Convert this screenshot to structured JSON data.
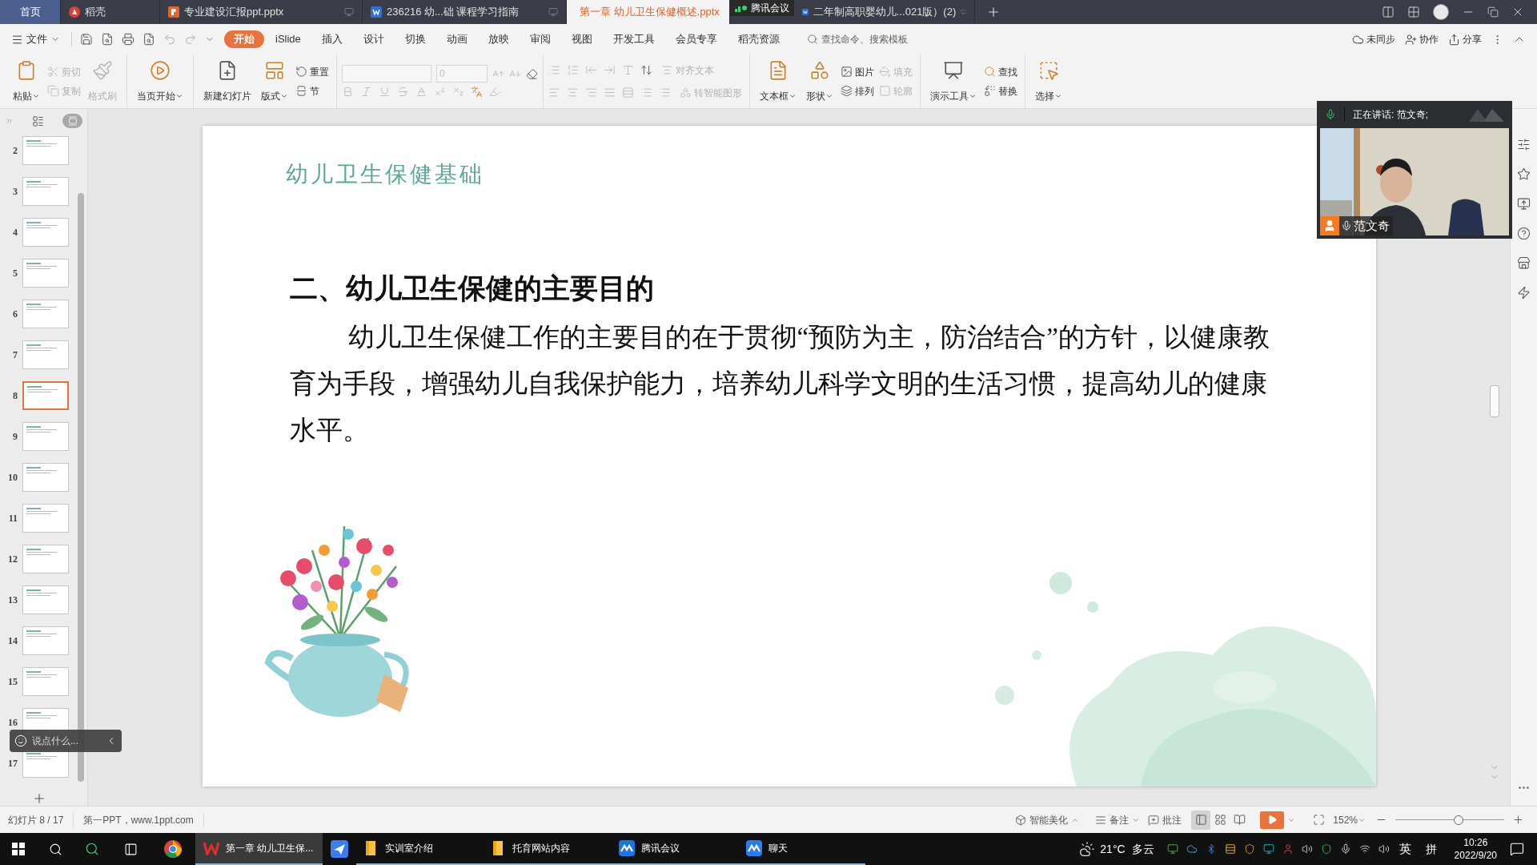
{
  "tabs": [
    {
      "label": "首页",
      "kind": "home",
      "selected": false
    },
    {
      "label": "稻壳",
      "kind": "docer",
      "selected": false
    },
    {
      "label": "专业建设汇报ppt.pptx",
      "kind": "pptx",
      "selected": false
    },
    {
      "label": "236216  幼...础  课程学习指南",
      "kind": "doc",
      "selected": false
    },
    {
      "label": "第一章 幼儿卫生保健概述.pptx",
      "kind": "pptx",
      "selected": true
    },
    {
      "label": "二年制高职婴幼儿...021版）(2)",
      "kind": "doc",
      "selected": false
    }
  ],
  "meeting_indicator": "腾讯会议",
  "menu": {
    "file": "文件",
    "tabs": [
      {
        "label": "开始",
        "selected": true
      },
      {
        "label": "iSlide",
        "selected": false
      },
      {
        "label": "插入",
        "selected": false
      },
      {
        "label": "设计",
        "selected": false
      },
      {
        "label": "切换",
        "selected": false
      },
      {
        "label": "动画",
        "selected": false
      },
      {
        "label": "放映",
        "selected": false
      },
      {
        "label": "审阅",
        "selected": false
      },
      {
        "label": "视图",
        "selected": false
      },
      {
        "label": "开发工具",
        "selected": false
      },
      {
        "label": "会员专享",
        "selected": false
      },
      {
        "label": "稻壳资源",
        "selected": false
      }
    ],
    "search": {
      "placeholder": "查找命令、搜索模板"
    },
    "sync": "未同步",
    "collaborate": "协作",
    "share": "分享"
  },
  "ribbon": {
    "paste": {
      "label": "粘贴",
      "disabled": false
    },
    "cut": {
      "label": "剪切",
      "disabled": true
    },
    "copy": {
      "label": "复制",
      "disabled": true
    },
    "format_painter": {
      "label": "格式刷",
      "disabled": true
    },
    "play_from_current": {
      "label": "当页开始",
      "disabled": false
    },
    "new_slide": {
      "label": "新建幻灯片",
      "disabled": false
    },
    "layout": {
      "label": "版式",
      "disabled": false
    },
    "reset": {
      "label": "重置",
      "disabled": false
    },
    "section": {
      "label": "节",
      "disabled": false
    },
    "font_size": {
      "value": "0"
    },
    "align_text": {
      "label": "对齐文本",
      "disabled": true
    },
    "smartart": {
      "label": "转智能图形",
      "disabled": true
    },
    "text_box": {
      "label": "文本框",
      "disabled": false
    },
    "shape": {
      "label": "形状",
      "disabled": false
    },
    "picture": {
      "label": "图片",
      "disabled": false
    },
    "fill": {
      "label": "填充",
      "disabled": true
    },
    "arrange": {
      "label": "排列",
      "disabled": false
    },
    "outline": {
      "label": "轮廓",
      "disabled": true
    },
    "presentation_tools": {
      "label": "演示工具",
      "disabled": false
    },
    "find": {
      "label": "查找",
      "disabled": false
    },
    "replace": {
      "label": "替换",
      "disabled": false
    },
    "select": {
      "label": "选择",
      "disabled": false
    }
  },
  "panel_views": [
    {
      "selected": false
    },
    {
      "selected": true
    }
  ],
  "slides": [
    {
      "number": "2",
      "selected": false
    },
    {
      "number": "3",
      "selected": false
    },
    {
      "number": "4",
      "selected": false
    },
    {
      "number": "5",
      "selected": false
    },
    {
      "number": "6",
      "selected": false
    },
    {
      "number": "7",
      "selected": false
    },
    {
      "number": "8",
      "selected": true
    },
    {
      "number": "9",
      "selected": false
    },
    {
      "number": "10",
      "selected": false
    },
    {
      "number": "11",
      "selected": false
    },
    {
      "number": "12",
      "selected": false
    },
    {
      "number": "13",
      "selected": false
    },
    {
      "number": "14",
      "selected": false
    },
    {
      "number": "15",
      "selected": false
    },
    {
      "number": "16",
      "selected": false
    },
    {
      "number": "17",
      "selected": false
    }
  ],
  "slide": {
    "title": "幼儿卫生保健基础",
    "heading": "二、幼儿卫生保健的主要目的",
    "body": "幼儿卫生保健工作的主要目的在于贯彻“预防为主，防治结合”的方针，以健康教育为手段，增强幼儿自我保护能力，培养幼儿科学文明的生活习惯，提高幼儿的健康水平。"
  },
  "video": {
    "speaking": "正在讲话: 范文奇;",
    "participant": "范文奇"
  },
  "chat": {
    "placeholder": "说点什么..."
  },
  "status_bar": {
    "slide_counter": "幻灯片 8 / 17",
    "theme": "第一PPT，www.1ppt.com",
    "smart_beautify": "智能美化",
    "notes": "备注",
    "comments": "批注",
    "view_modes": [
      {
        "selected": true
      },
      {
        "selected": false
      },
      {
        "selected": false
      }
    ],
    "zoom": "152%",
    "zoom_slider": {
      "level": 0.58
    }
  },
  "taskbar": {
    "apps": [
      {
        "label": "第一章 幼儿卫生保...",
        "kind": "wps",
        "selected": true
      },
      {
        "label": "实训室介绍",
        "kind": "folder",
        "selected": false
      },
      {
        "label": "托育网站内容",
        "kind": "folder",
        "selected": false
      },
      {
        "label": "腾讯会议",
        "kind": "meeting",
        "selected": false
      },
      {
        "label": "聊天",
        "kind": "chat",
        "selected": false
      }
    ],
    "temperature": "21°C",
    "weather": "多云",
    "ime_language": "英",
    "ime_mode": "拼",
    "time": "10:26",
    "date": "2022/9/20"
  }
}
